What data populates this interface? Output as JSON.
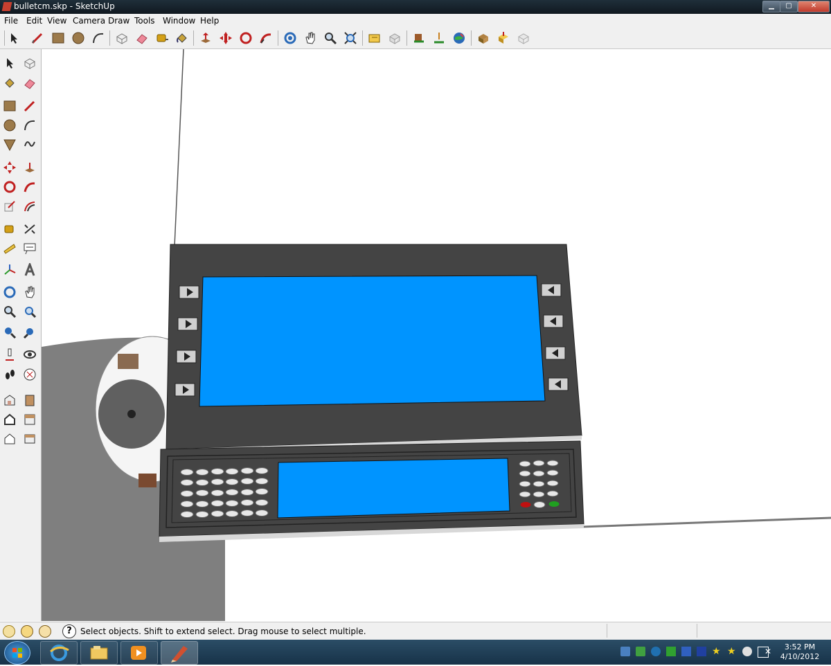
{
  "window": {
    "title": "bulletcm.skp - SketchUp",
    "min": "▁",
    "max": "▢",
    "close": "✕"
  },
  "menu": [
    "File",
    "Edit",
    "View",
    "Camera",
    "Draw",
    "Tools",
    "Window",
    "Help"
  ],
  "toolbar_icons": [
    "select-icon",
    "pencil-icon",
    "rectangle-icon",
    "circle-icon",
    "arc-icon",
    "make-component-icon",
    "eraser-icon",
    "tape-measure-icon",
    "paint-bucket-icon",
    "push-pull-icon",
    "move-icon",
    "rotate-icon",
    "follow-me-icon",
    "orbit-icon",
    "pan-icon",
    "zoom-icon",
    "zoom-extents-icon",
    "get-models-icon",
    "share-model-icon",
    "place-model-icon",
    "get-current-view-icon",
    "google-earth-icon",
    "get-photo-texture-icon",
    "share-component-icon",
    "component-warehouse-icon"
  ],
  "left_icons": [
    "select-icon",
    "make-component-icon",
    "paint-bucket-icon",
    "eraser-icon",
    "rectangle-icon",
    "line-icon",
    "circle-icon",
    "arc-icon",
    "polygon-icon",
    "freehand-icon",
    "move-icon",
    "push-pull-icon",
    "rotate-icon",
    "follow-me-icon",
    "scale-icon",
    "offset-icon",
    "tape-measure-icon",
    "dimension-icon",
    "protractor-icon",
    "text-icon",
    "axes-icon",
    "3d-text-icon",
    "orbit-icon",
    "pan-icon",
    "zoom-icon",
    "zoom-window-icon",
    "previous-view-icon",
    "zoom-extents-icon",
    "position-camera-icon",
    "look-around-icon",
    "walk-icon",
    "section-plane-icon",
    "iso-view-icon",
    "top-view-icon",
    "front-view-icon",
    "right-view-icon",
    "back-view-icon",
    "left-view-icon"
  ],
  "status": {
    "message": "Select objects. Shift to extend select. Drag mouse to select multiple."
  },
  "clock": {
    "time": "3:52 PM",
    "date": "4/10/2012"
  },
  "colors": {
    "screen": "#0094ff",
    "panel": "#444444"
  }
}
